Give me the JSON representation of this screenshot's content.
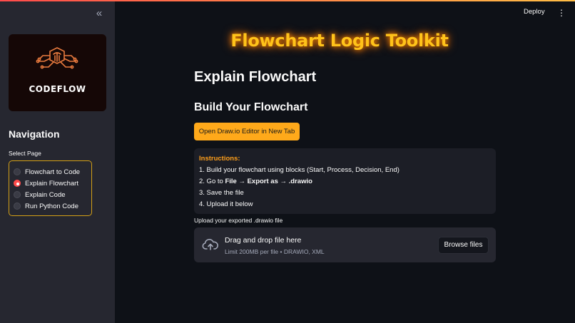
{
  "sidebar": {
    "collapse_icon": "«",
    "logo_text": "CODEFLOW",
    "nav_title": "Navigation",
    "select_label": "Select Page",
    "pages": [
      {
        "label": "Flowchart to Code",
        "selected": false
      },
      {
        "label": "Explain Flowchart",
        "selected": true
      },
      {
        "label": "Explain Code",
        "selected": false
      },
      {
        "label": "Run Python Code",
        "selected": false
      }
    ]
  },
  "header": {
    "deploy_label": "Deploy",
    "menu_icon": "⋮"
  },
  "main": {
    "app_title": "Flowchart Logic Toolkit",
    "page_heading": "Explain Flowchart",
    "section_heading": "Build Your Flowchart",
    "open_button": "Open Draw.io Editor in New Tab",
    "instructions": {
      "title": "Instructions:",
      "step1": "1. Build your flowchart using blocks (Start, Process, Decision, End)",
      "step2_prefix": "2. Go to ",
      "step2_bold": "File → Export as → .drawio",
      "step3": "3. Save the file",
      "step4": "4. Upload it below"
    },
    "upload": {
      "label": "Upload your exported .drawio file",
      "drop_title": "Drag and drop file here",
      "drop_sub": "Limit 200MB per file • DRAWIO, XML",
      "browse_label": "Browse files"
    }
  },
  "colors": {
    "accent": "#ff4b4b",
    "title_glow": "#ffc31a",
    "button": "#ffa91a",
    "instructions_title": "#ff9f1a",
    "radio_border": "#d4a017"
  }
}
